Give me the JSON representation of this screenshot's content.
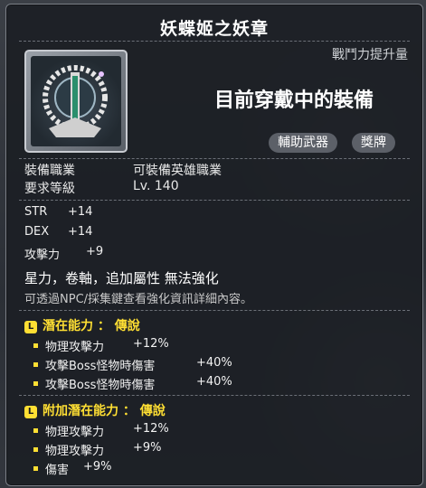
{
  "item": {
    "name": "妖蝶姬之妖章",
    "power_note": "戰鬥力提升量",
    "equipped_label": "目前穿戴中的裝備",
    "tags": [
      "輔助武器",
      "獎牌"
    ]
  },
  "requirements": {
    "job_label": "裝備職業",
    "job_value": "可裝備英雄職業",
    "level_label": "要求等級",
    "level_value": "Lv. 140"
  },
  "stats": [
    {
      "name": "STR",
      "value": "+14"
    },
    {
      "name": "DEX",
      "value": "+14"
    },
    {
      "name": "攻擊力",
      "value": "+9"
    }
  ],
  "attributes": "星力，卷軸，追加屬性 無法強化",
  "info_note": "可透過NPC/採集鍵查看強化資訊詳細內容。",
  "potential": {
    "title": "潛在能力 ： 傳說",
    "icon_letter": "L",
    "lines": [
      {
        "text": "物理攻擊力",
        "value": "+12%"
      },
      {
        "text": "攻擊Boss怪物時傷害",
        "value": "+40%"
      },
      {
        "text": "攻擊Boss怪物時傷害",
        "value": "+40%"
      }
    ]
  },
  "additional_potential": {
    "title": "附加潛在能力 ： 傳說",
    "icon_letter": "L",
    "lines": [
      {
        "text": "物理攻擊力",
        "value": "+12%"
      },
      {
        "text": "物理攻擊力",
        "value": "+9%"
      },
      {
        "text": "傷害",
        "value": "+9%"
      }
    ]
  },
  "colors": {
    "potential_gold": "#ffdf33",
    "tooltip_bg": "#1c1f25"
  }
}
